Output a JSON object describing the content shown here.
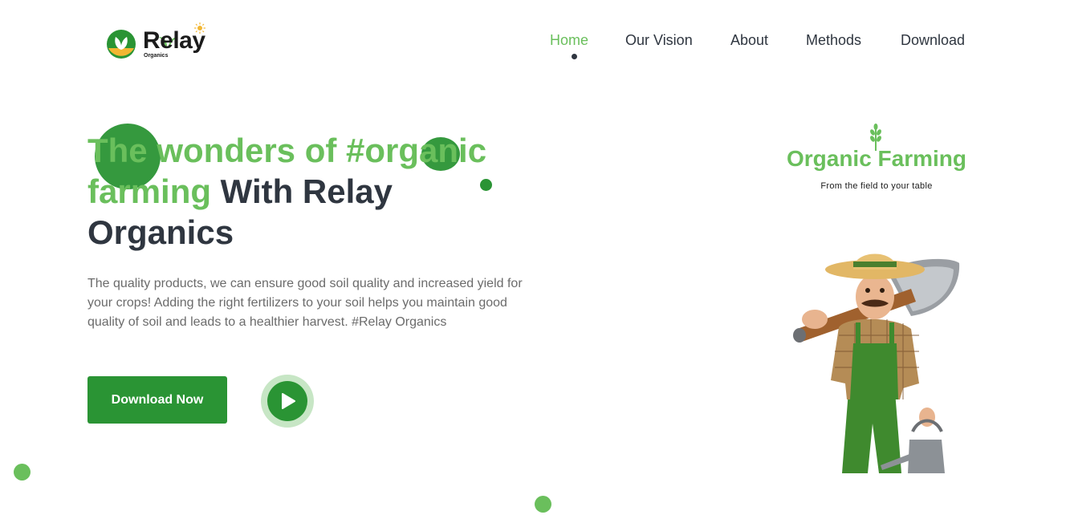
{
  "header": {
    "logo_text": "Relay",
    "logo_sub": "Organics",
    "nav": [
      {
        "label": "Home",
        "active": true
      },
      {
        "label": "Our Vision",
        "active": false
      },
      {
        "label": "About",
        "active": false
      },
      {
        "label": "Methods",
        "active": false
      },
      {
        "label": "Download",
        "active": false
      }
    ]
  },
  "hero": {
    "title_green_1": "The wonders of #organic",
    "title_green_2": "farming",
    "title_dark_1": " With Relay",
    "title_dark_2": "Organics",
    "description": "The quality products, we can ensure good soil quality and increased yield for your crops! Adding the right fertilizers to your soil helps you maintain good quality of soil and leads to a healthier harvest. #Relay Organics",
    "download_label": "Download Now",
    "play_icon": "play-icon"
  },
  "brand": {
    "title": "Organic Farming",
    "subtitle": "From the field to your table"
  },
  "colors": {
    "accent_light": "#6abf5c",
    "accent_dark": "#2a9434",
    "text_dark": "#2f3640"
  }
}
